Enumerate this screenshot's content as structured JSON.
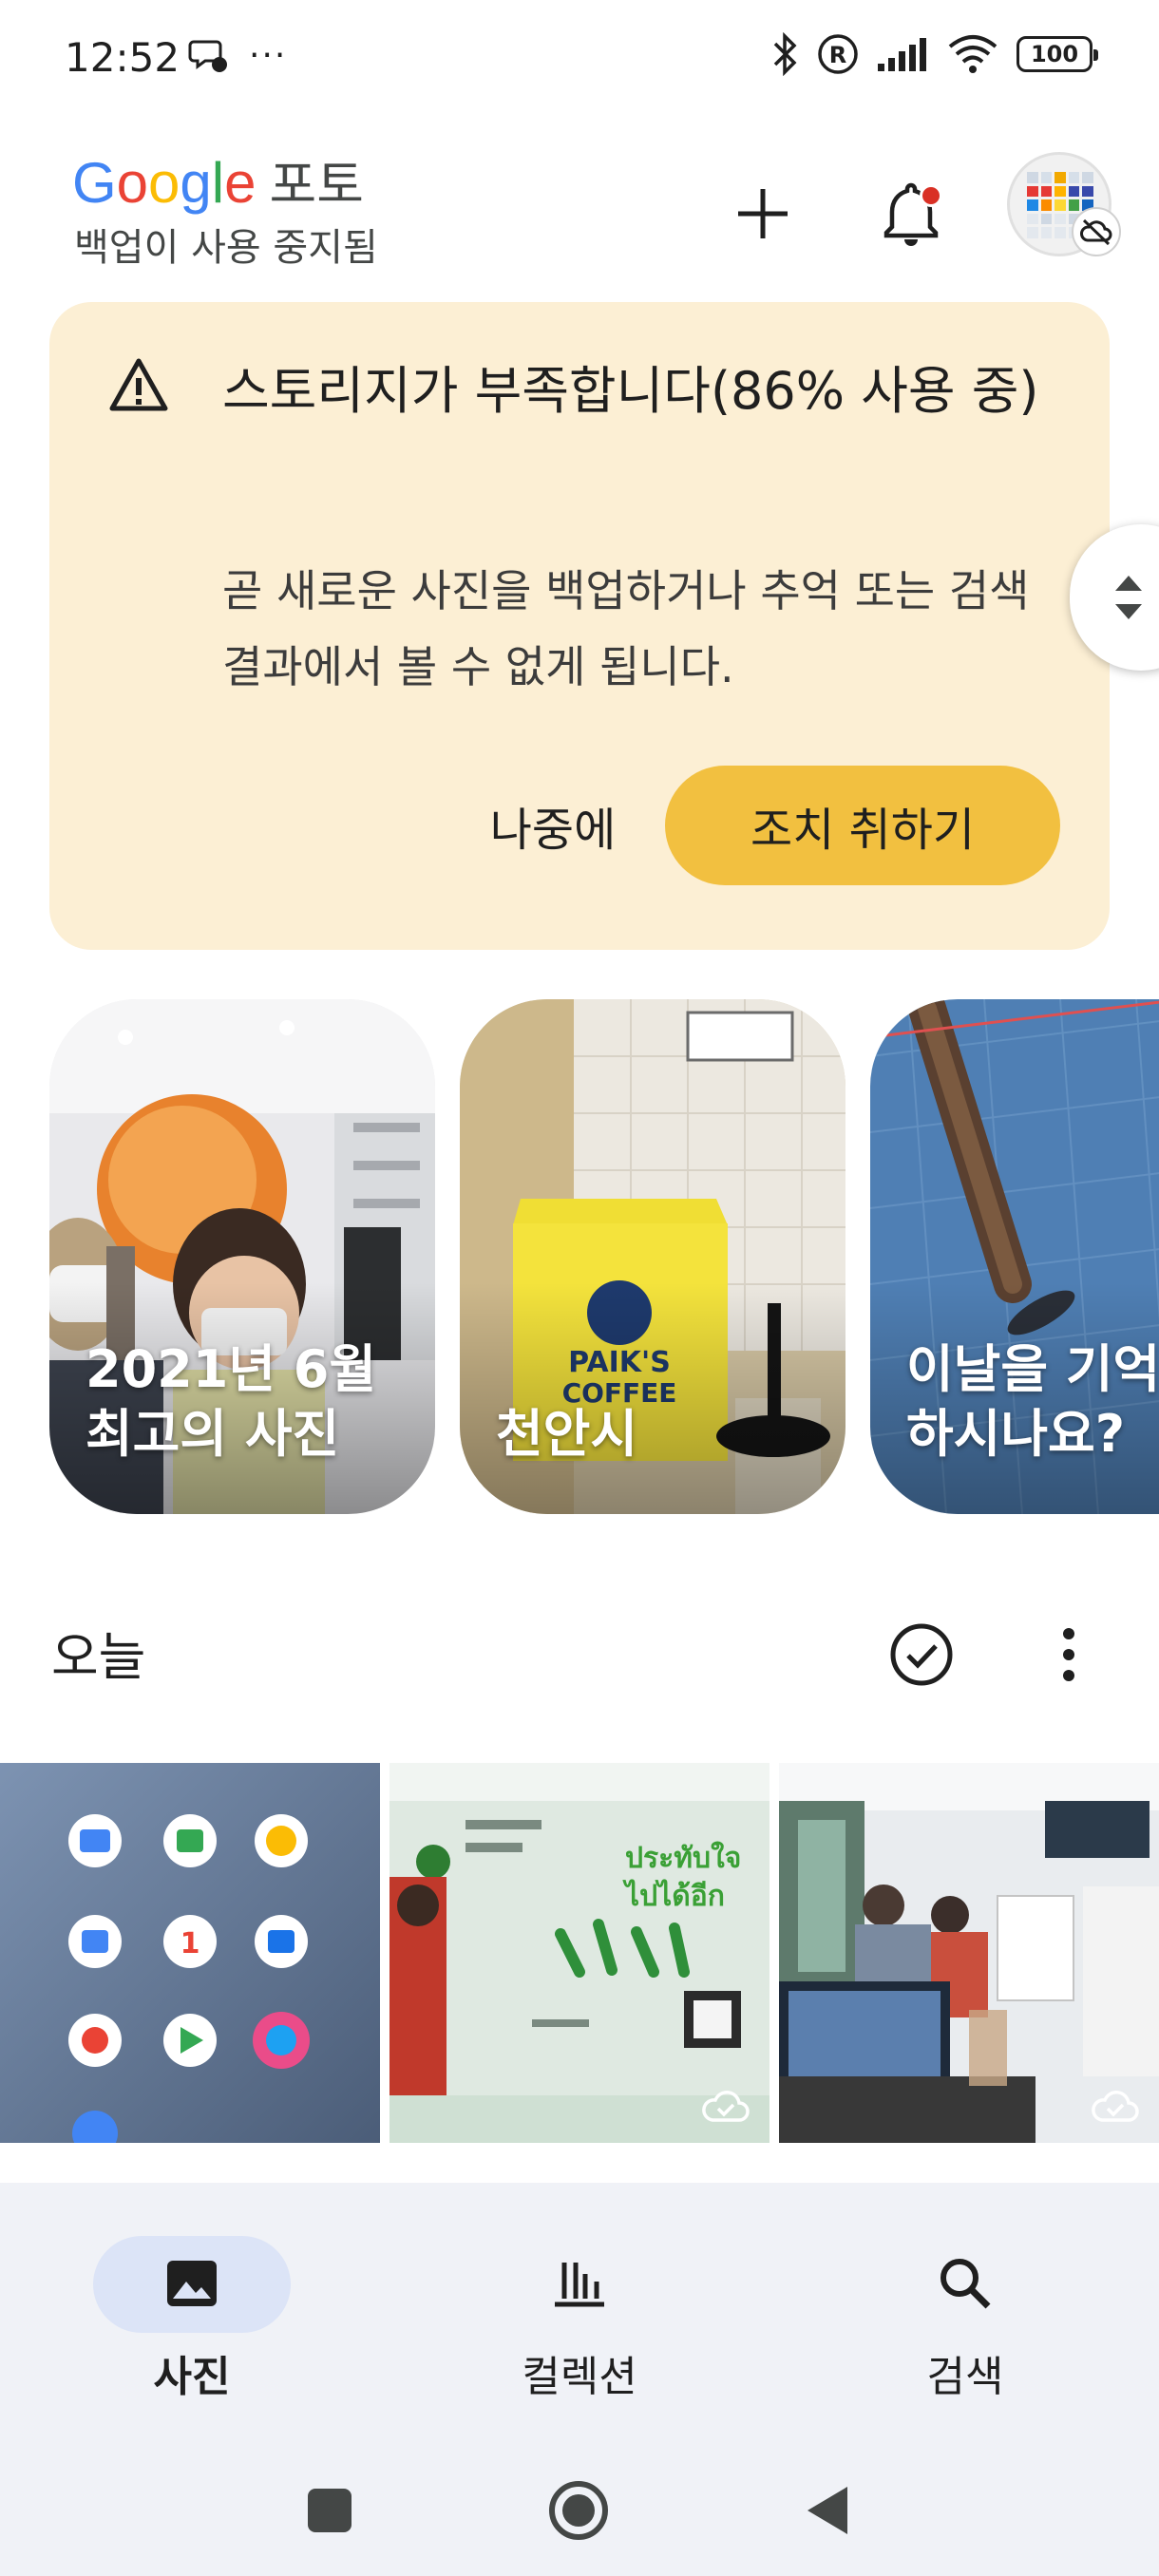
{
  "status_bar": {
    "time": "12:52",
    "left_icons": [
      "messenger-icon",
      "more-dots-icon"
    ],
    "overflow_glyph": "···",
    "right_icons": [
      "bluetooth-icon",
      "registered-icon",
      "signal-icon",
      "wifi-icon"
    ],
    "battery": "100"
  },
  "header": {
    "logo_letters": [
      "G",
      "o",
      "o",
      "g",
      "l",
      "e"
    ],
    "product": "포토",
    "backup_status": "백업이 사용 중지됨",
    "add_icon": "plus-icon",
    "notification_icon": "bell-icon",
    "notification_dot_color": "#d93025",
    "avatar_badge_icon": "cloud-off-icon"
  },
  "storage_warning": {
    "title": "스토리지가 부족합니다(86% 사용 중)",
    "description": "곧 새로운 사진을 백업하거나 추억 또는 검색결과에서 볼 수 없게 됩니다.",
    "later_label": "나중에",
    "action_label": "조치 취하기",
    "background_color": "#fcefd4",
    "action_color": "#f2c040"
  },
  "memories": [
    {
      "label_line1": "2021년 6월",
      "label_line2": "최고의 사진"
    },
    {
      "label_line1": "천안시",
      "label_line2": ""
    },
    {
      "label_line1": "이날을 기억",
      "label_line2": "하시나요?"
    }
  ],
  "today": {
    "title": "오늘",
    "photos": [
      {
        "kind": "phone-home-screen"
      },
      {
        "kind": "payment-receipt"
      },
      {
        "kind": "cafe-interior"
      }
    ]
  },
  "bottom_nav": {
    "items": [
      {
        "label": "사진",
        "icon": "photo-icon",
        "active": true
      },
      {
        "label": "컬렉션",
        "icon": "library-icon",
        "active": false
      },
      {
        "label": "검색",
        "icon": "search-icon",
        "active": false
      }
    ]
  },
  "system_nav": [
    "recents-icon",
    "home-icon",
    "back-icon"
  ]
}
